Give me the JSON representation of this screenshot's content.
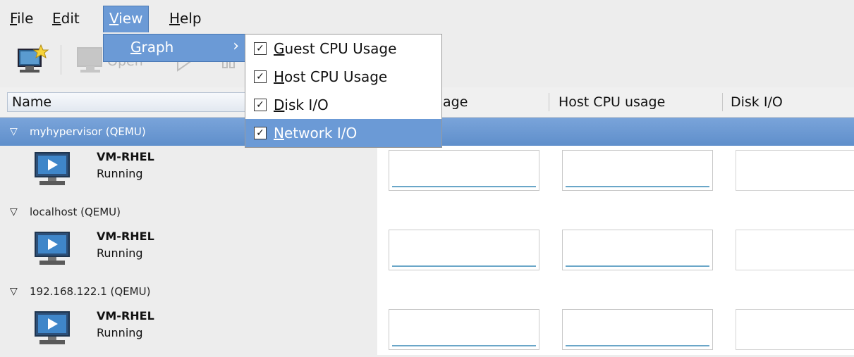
{
  "menubar": {
    "items": [
      {
        "label": "File",
        "mnemonic": "F",
        "rest": "ile"
      },
      {
        "label": "Edit",
        "mnemonic": "E",
        "rest": "dit"
      },
      {
        "label": "View",
        "mnemonic": "V",
        "rest": "iew"
      },
      {
        "label": "Help",
        "mnemonic": "H",
        "rest": "elp"
      }
    ]
  },
  "view_menu": {
    "graph": {
      "label": "Graph",
      "mnemonic": "G",
      "rest": "raph",
      "arrow": "›"
    }
  },
  "graph_submenu": {
    "items": [
      {
        "label": "Guest CPU Usage",
        "mnemonic": "G",
        "rest": "uest CPU Usage",
        "checked": true,
        "check": "✓"
      },
      {
        "label": "Host CPU Usage",
        "mnemonic": "H",
        "rest": "ost CPU Usage",
        "checked": true,
        "check": "✓"
      },
      {
        "label": "Disk I/O",
        "mnemonic": "D",
        "rest": "isk I/O",
        "checked": true,
        "check": "✓"
      },
      {
        "label": "Network I/O",
        "mnemonic": "N",
        "rest": "etwork I/O",
        "checked": true,
        "check": "✓"
      }
    ]
  },
  "toolbar": {
    "open_label": "Open"
  },
  "columns": {
    "name": "Name",
    "guest_partial": "age",
    "host_cpu": "Host CPU usage",
    "disk_io": "Disk I/O"
  },
  "connections": [
    {
      "name": "myhypervisor (QEMU)",
      "expander": "▽",
      "selected": true,
      "vm": {
        "name": "VM-RHEL",
        "status": "Running"
      }
    },
    {
      "name": "localhost (QEMU)",
      "expander": "▽",
      "selected": false,
      "vm": {
        "name": "VM-RHEL",
        "status": "Running"
      }
    },
    {
      "name": "192.168.122.1 (QEMU)",
      "expander": "▽",
      "selected": false,
      "vm": {
        "name": "VM-RHEL",
        "status": "Running"
      }
    }
  ],
  "colors": {
    "selection": "#6b9ad6",
    "graph_line": "#6aa6c8"
  },
  "icons": [
    "new-vm-icon",
    "open-vm-icon",
    "run-icon",
    "pause-icon",
    "monitor-icon"
  ]
}
